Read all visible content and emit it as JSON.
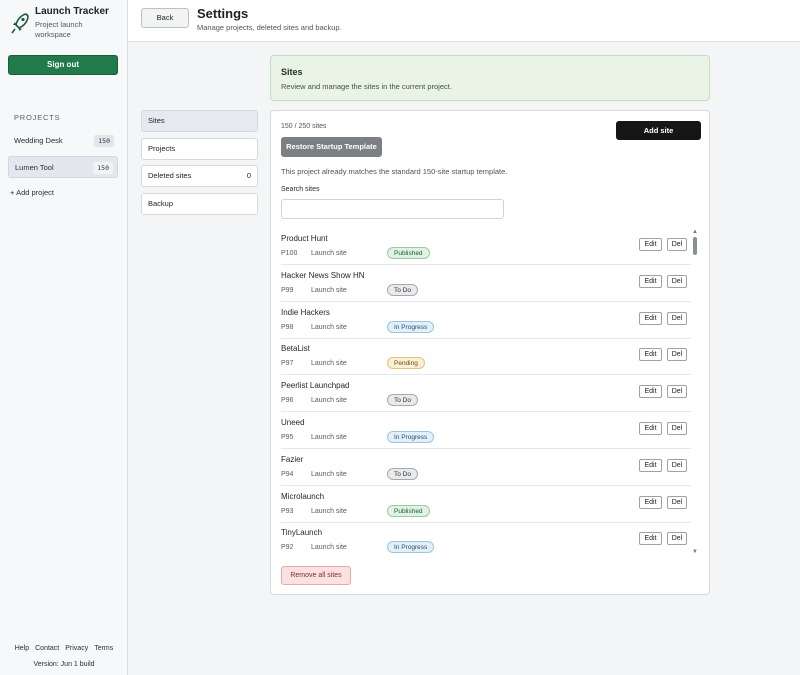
{
  "app": {
    "title": "Launch Tracker",
    "subtitle": "Project launch workspace",
    "sign_out_label": "Sign out"
  },
  "sidebar": {
    "projects_heading": "PROJECTS",
    "projects": [
      {
        "name": "Wedding Desk",
        "count": "150",
        "active": false
      },
      {
        "name": "Lumen Tool",
        "count": "150",
        "active": true
      }
    ],
    "add_project_icon": "+",
    "add_project_label": "Add project",
    "footer_links": [
      "Help",
      "Contact",
      "Privacy",
      "Terms"
    ],
    "version": "Version: Jun 1 build"
  },
  "header": {
    "back_label": "Back",
    "title": "Settings",
    "subtitle": "Manage projects, deleted sites and backup."
  },
  "section_nav": [
    {
      "label": "Sites",
      "count": "",
      "active": true
    },
    {
      "label": "Projects",
      "count": "",
      "active": false
    },
    {
      "label": "Deleted sites",
      "count": "0",
      "active": false
    },
    {
      "label": "Backup",
      "count": "",
      "active": false
    }
  ],
  "banner": {
    "title": "Sites",
    "subtitle": "Review and manage the sites in the current project."
  },
  "sites_panel": {
    "count_text": "150 / 250 sites",
    "add_site_label": "Add site",
    "restore_label": "Restore Startup Template",
    "template_note": "This project already matches the standard 150-site startup template.",
    "search_label": "Search sites",
    "search_value": "",
    "search_placeholder": "",
    "edit_label": "Edit",
    "del_label": "Del",
    "remove_all_label": "Remove all sites",
    "scroll_up_glyph": "▲",
    "scroll_down_glyph": "▼"
  },
  "sites": [
    {
      "name": "Product Hunt",
      "id": "P100",
      "type": "Launch site",
      "status": "Published",
      "status_key": "published"
    },
    {
      "name": "Hacker News Show HN",
      "id": "P99",
      "type": "Launch site",
      "status": "To Do",
      "status_key": "todo"
    },
    {
      "name": "Indie Hackers",
      "id": "P98",
      "type": "Launch site",
      "status": "In Progress",
      "status_key": "inprogress"
    },
    {
      "name": "BetaList",
      "id": "P97",
      "type": "Launch site",
      "status": "Pending",
      "status_key": "pending"
    },
    {
      "name": "Peerlist Launchpad",
      "id": "P96",
      "type": "Launch site",
      "status": "To Do",
      "status_key": "todo"
    },
    {
      "name": "Uneed",
      "id": "P95",
      "type": "Launch site",
      "status": "In Progress",
      "status_key": "inprogress"
    },
    {
      "name": "Fazier",
      "id": "P94",
      "type": "Launch site",
      "status": "To Do",
      "status_key": "todo"
    },
    {
      "name": "Microlaunch",
      "id": "P93",
      "type": "Launch site",
      "status": "Published",
      "status_key": "published"
    },
    {
      "name": "TinyLaunch",
      "id": "P92",
      "type": "Launch site",
      "status": "In Progress",
      "status_key": "inprogress"
    }
  ],
  "colors": {
    "sign_out": "#217a4a",
    "add_site": "#141618",
    "banner_bg": "#e9f3e6",
    "remove_all_bg": "#fbe1e1"
  }
}
